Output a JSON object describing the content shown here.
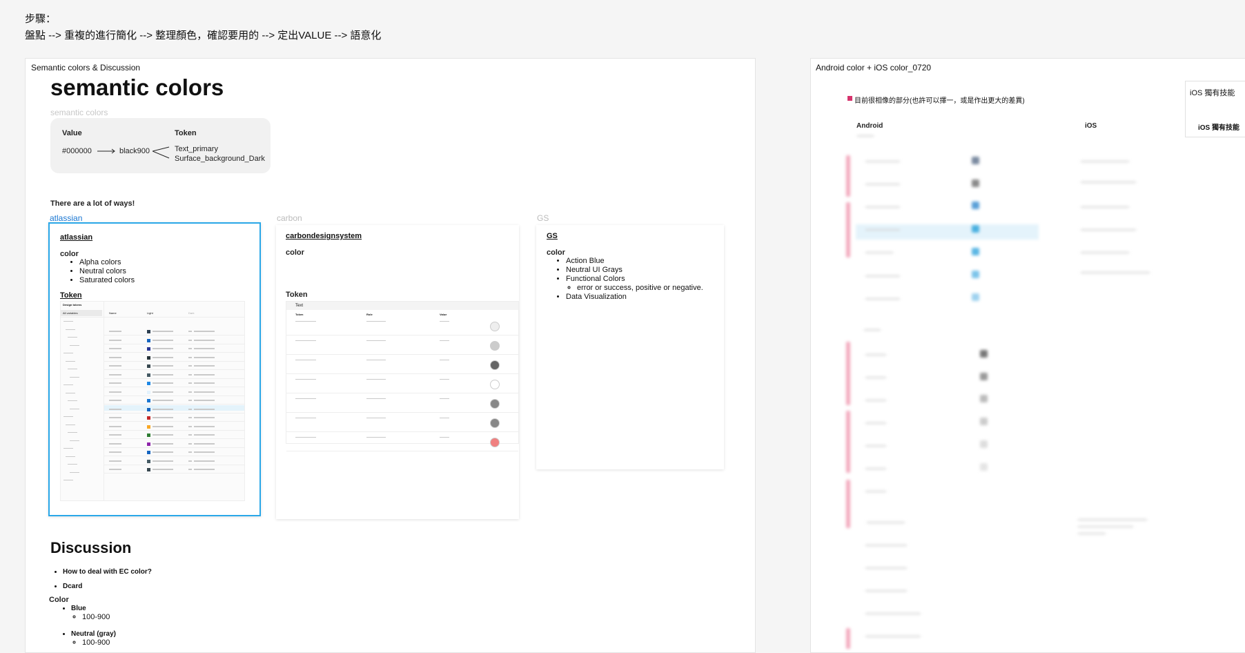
{
  "steps": {
    "title": "步驟：",
    "line": "盤點 --> 重複的進行簡化 --> 整理顏色，確認要用的  -->  定出VALUE --> 語意化"
  },
  "left_frame": {
    "label": "Semantic colors & Discussion",
    "heading": "semantic colors",
    "subheading": "semantic colors",
    "value_token": {
      "value_header": "Value",
      "token_header": "Token",
      "hex": "#000000",
      "name": "black900",
      "token1": "Text_primary",
      "token2": "Surface_background_Dark"
    },
    "ways_title": "There are a lot of ways!",
    "tabs": [
      "atlassian",
      "carbon",
      "GS"
    ],
    "cards": {
      "atlassian": {
        "title": "atlassian",
        "color_title": "color",
        "items": [
          "Alpha colors",
          "Neutral colors",
          "Saturated colors"
        ],
        "token_title": "Token",
        "mini_header": "Design tokens",
        "mini_all": "All variables",
        "mini_cols": [
          "Name",
          "Light",
          "Dark"
        ]
      },
      "carbon": {
        "title": "carbondesignsystem",
        "color_title": "color",
        "token_title": "Token",
        "table_title": "Text",
        "cols": [
          "Token",
          "Role",
          "Value"
        ]
      },
      "gs": {
        "title": "GS",
        "color_title": "color",
        "items": [
          "Action Blue",
          "Neutral UI Grays",
          "Functional Colors"
        ],
        "sub_item": "error or success, positive or negative.",
        "last_item": "Data Visualization"
      }
    },
    "discussion": {
      "title": "Discussion",
      "items": [
        "How to deal with EC color?",
        "Dcard"
      ],
      "color_title": "Color",
      "groups": [
        {
          "name": "Blue",
          "range": "100-900"
        },
        {
          "name": "Neutral (gray)",
          "range": "100-900"
        }
      ]
    }
  },
  "right_frame": {
    "label": "Android color + iOS color_0720",
    "legend": "目前很相像的部分(也許可以擇一，或是作出更大的差異)",
    "col_android": "Android",
    "col_ios": "iOS",
    "ios_tab": "iOS 獨有技能",
    "ios_tab_header": "iOS 獨有技能",
    "colors": {
      "pink": "#f2a9bd",
      "legend_square": "#d6336c",
      "selection": "#29a7e8"
    }
  }
}
